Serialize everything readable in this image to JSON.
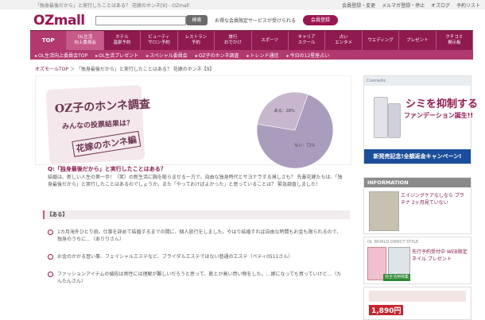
{
  "window": {
    "tagline": "「独身最後だから」と実行したことはある？ 花嫁のホンネ[9] - OZmall"
  },
  "toplinks": [
    "会員登録・変更",
    "メルマガ登録・停止",
    "オズログ",
    "予約リスト"
  ],
  "header": {
    "logo": "OZmall",
    "search_placeholder": "",
    "search_button": "検索",
    "promo_text": "お得な会員限定サービスが受けられる",
    "member_button": "会員登録"
  },
  "nav": {
    "items": [
      {
        "label": "TOP"
      },
      {
        "label": "OL生活\n向上委員会"
      },
      {
        "label": "ホテル\n温泉予約"
      },
      {
        "label": "ビューティ\nサロン予約"
      },
      {
        "label": "レストラン\n予約"
      },
      {
        "label": "旅行\nおでかけ"
      },
      {
        "label": "スポーツ"
      },
      {
        "label": "キャリア\nスクール"
      },
      {
        "label": "占い\nエンタメ"
      },
      {
        "label": "ウエディング"
      },
      {
        "label": "プレゼント"
      },
      {
        "label": "クチコミ\n掲示板"
      }
    ]
  },
  "subnav": {
    "items": [
      "OL生活向上委員会TOP",
      "OL生活プレゼント",
      "スペシャル委員会",
      "OZ子のホンネ調査",
      "トレンド通信",
      "今日の12星座占い"
    ]
  },
  "breadcrumb": {
    "home": "オズモールTOP",
    "sep": " ＞ ",
    "current": "「独身最後だから」と実行したことはある？ 花嫁のホンネ【9】"
  },
  "hero": {
    "stamp_title": "OZ子のホンネ調査",
    "stamp_sub": "みんなの投票結果は？",
    "stamp_tag": "花嫁のホンネ編"
  },
  "chart_data": {
    "type": "pie",
    "categories": [
      "ある",
      "ない"
    ],
    "values": [
      28,
      72
    ],
    "labels": [
      "ある：28%",
      "ない：72%"
    ],
    "colors": [
      "#c7b6ce",
      "#a99cbd"
    ]
  },
  "content": {
    "question": "Q:「独身最後だから」と実行したことはある？",
    "intro": "結婚は、新しい人生の第一歩！（笑）の新生活に胸を膨らませる一方で、自由な独身時代とサヨナラする淋しさも？ 先輩花嫁たちは、「独身最後だから」と実行したことはあるのでしょうか。また「やっておけばよかった」と思っていることは？ 緊急調査しました！",
    "section_head": "【ある】",
    "answers": [
      "1カ月海外ひとり旅。仕事を辞めて結婚するまでの間に、個人旅行をしました。やはり結婚すれば自由な時間もお金も限られるので、独身のうちに…（ありりさん）",
      "お金のかかる習い事、フェイシャルエステなど、ブライダルエステではない普通のエステ（ペティ0511さん）",
      "ファッションアイテムの値段は男性には理解が難しいだろうと思って、靴とか高い買い物をした。…嫁になっても買っていけど…（たんたんさん）"
    ]
  },
  "sidebar": {
    "ad1": {
      "bar": "Cosmedic",
      "big": "シミを抑制する",
      "small": "ファンデーション誕生!!",
      "badge": "新発売記念!全額返金キャンペーン!"
    },
    "info": {
      "head": "INFORMATION",
      "text": "エイジングケアなしなら プラチナ 2ヶ月見ていない"
    },
    "ad3": {
      "label": "OL WORLD DIRECT STYLE",
      "text": "先行予約受付中 WEB限定 ネイル プレゼント",
      "strip": "完全活用特集"
    },
    "ad4": {
      "price": "1,890円"
    }
  }
}
